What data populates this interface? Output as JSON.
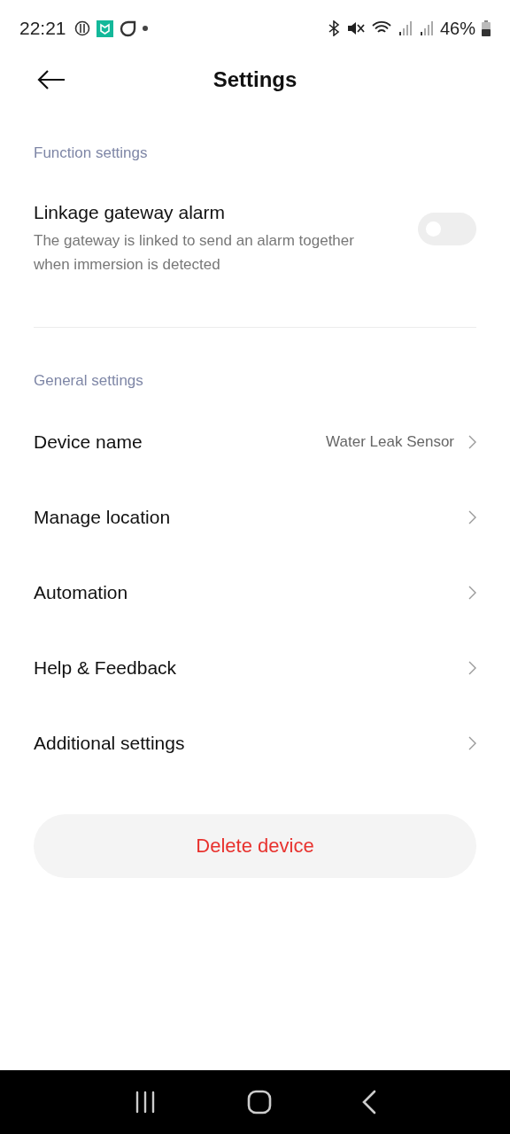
{
  "status_bar": {
    "time": "22:21",
    "battery": "46%"
  },
  "header": {
    "title": "Settings"
  },
  "sections": [
    {
      "title": "Function settings",
      "items": [
        {
          "kind": "toggle",
          "label": "Linkage gateway alarm",
          "description": "The gateway is linked to send an alarm together when immersion is detected",
          "on": false
        }
      ]
    },
    {
      "title": "General settings",
      "items": [
        {
          "kind": "link",
          "label": "Device name",
          "value": "Water Leak Sensor"
        },
        {
          "kind": "link",
          "label": "Manage location"
        },
        {
          "kind": "link",
          "label": "Automation"
        },
        {
          "kind": "link",
          "label": "Help & Feedback"
        },
        {
          "kind": "link",
          "label": "Additional settings"
        }
      ]
    }
  ],
  "delete_button": {
    "label": "Delete device"
  }
}
